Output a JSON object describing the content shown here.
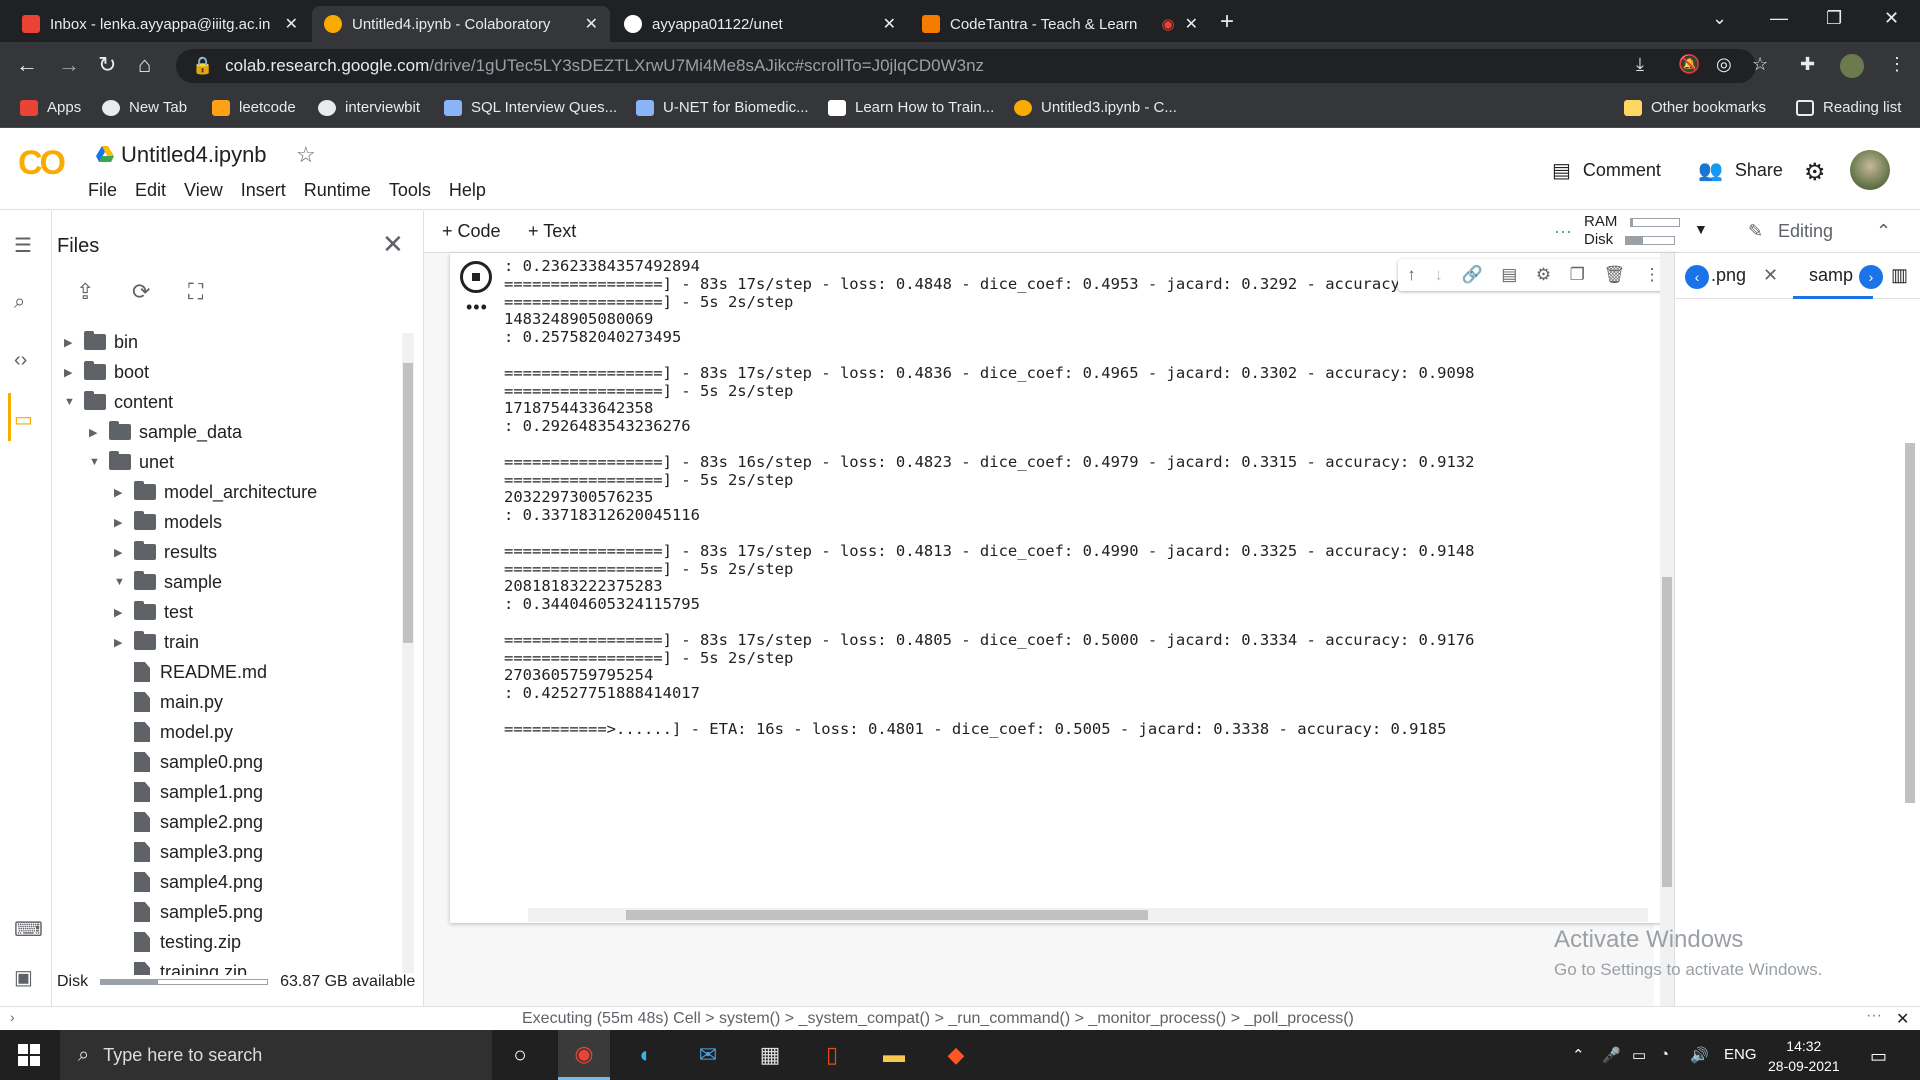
{
  "browser": {
    "tabs": [
      {
        "title": "Inbox - lenka.ayyappa@iiitg.ac.in",
        "icon": "gmail-icon",
        "color": "#ea4335"
      },
      {
        "title": "Untitled4.ipynb - Colaboratory",
        "icon": "colab-icon",
        "color": "#f9ab00"
      },
      {
        "title": "ayyappa01122/unet",
        "icon": "github-icon",
        "color": "#ffffff"
      },
      {
        "title": "CodeTantra - Teach & Learn",
        "icon": "codetantra-icon",
        "color": "#f57c00"
      }
    ],
    "url_host": "colab.research.google.com",
    "url_path": "/drive/1gUTec5LY3sDEZTLXrwU7Mi4Me8sAJikc#scrollTo=J0jlqCD0W3nz",
    "bookmarks": [
      {
        "label": "Apps",
        "color": "#ea4335"
      },
      {
        "label": "New Tab",
        "color": "#e8eaed"
      },
      {
        "label": "leetcode",
        "color": "#ffa116"
      },
      {
        "label": "interviewbit",
        "color": "#e8eaed"
      },
      {
        "label": "SQL Interview Ques...",
        "color": "#8ab4f8"
      },
      {
        "label": "U-NET for Biomedic...",
        "color": "#8ab4f8"
      },
      {
        "label": "Learn How to Train...",
        "color": "#ffffff"
      },
      {
        "label": "Untitled3.ipynb - C...",
        "color": "#f9ab00"
      }
    ],
    "other_bookmarks": "Other bookmarks",
    "reading_list": "Reading list"
  },
  "colab": {
    "logo": "CO",
    "notebook_title": "Untitled4.ipynb",
    "menu": [
      "File",
      "Edit",
      "View",
      "Insert",
      "Runtime",
      "Tools",
      "Help"
    ],
    "comment": "Comment",
    "share": "Share",
    "add_code": "+ Code",
    "add_text": "+ Text",
    "ram_label": "RAM",
    "disk_label": "Disk",
    "ram_fraction": 0.06,
    "disk_fraction": 0.35,
    "editing": "Editing"
  },
  "files": {
    "title": "Files",
    "tree": [
      {
        "name": "bin",
        "type": "folder",
        "depth": 0,
        "state": "collapsed"
      },
      {
        "name": "boot",
        "type": "folder",
        "depth": 0,
        "state": "collapsed"
      },
      {
        "name": "content",
        "type": "folder",
        "depth": 0,
        "state": "expanded"
      },
      {
        "name": "sample_data",
        "type": "folder",
        "depth": 1,
        "state": "collapsed"
      },
      {
        "name": "unet",
        "type": "folder",
        "depth": 1,
        "state": "expanded"
      },
      {
        "name": "model_architecture",
        "type": "folder",
        "depth": 2,
        "state": "collapsed"
      },
      {
        "name": "models",
        "type": "folder",
        "depth": 2,
        "state": "collapsed"
      },
      {
        "name": "results",
        "type": "folder",
        "depth": 2,
        "state": "collapsed"
      },
      {
        "name": "sample",
        "type": "folder",
        "depth": 2,
        "state": "expanded"
      },
      {
        "name": "test",
        "type": "folder",
        "depth": 2,
        "state": "collapsed"
      },
      {
        "name": "train",
        "type": "folder",
        "depth": 2,
        "state": "collapsed"
      },
      {
        "name": "README.md",
        "type": "file",
        "depth": 2
      },
      {
        "name": "main.py",
        "type": "file",
        "depth": 2
      },
      {
        "name": "model.py",
        "type": "file",
        "depth": 2
      },
      {
        "name": "sample0.png",
        "type": "file",
        "depth": 2
      },
      {
        "name": "sample1.png",
        "type": "file",
        "depth": 2
      },
      {
        "name": "sample2.png",
        "type": "file",
        "depth": 2
      },
      {
        "name": "sample3.png",
        "type": "file",
        "depth": 2
      },
      {
        "name": "sample4.png",
        "type": "file",
        "depth": 2
      },
      {
        "name": "sample5.png",
        "type": "file",
        "depth": 2
      },
      {
        "name": "testing.zip",
        "type": "file",
        "depth": 2
      },
      {
        "name": "training.zip",
        "type": "file",
        "depth": 2
      }
    ],
    "disk_label": "Disk",
    "disk_fraction": 0.34,
    "disk_available": "63.87 GB available"
  },
  "output_lines": [
    ": 0.23623384357492894",
    "=================] - 83s 17s/step - loss: 0.4848 - dice_coef: 0.4953 - jacard: 0.3292 - accuracy: 0.9067",
    "=================] - 5s 2s/step",
    "1483248905080069",
    ": 0.257582040273495",
    "",
    "=================] - 83s 17s/step - loss: 0.4836 - dice_coef: 0.4965 - jacard: 0.3302 - accuracy: 0.9098",
    "=================] - 5s 2s/step",
    "1718754433642358",
    ": 0.2926483543236276",
    "",
    "=================] - 83s 16s/step - loss: 0.4823 - dice_coef: 0.4979 - jacard: 0.3315 - accuracy: 0.9132",
    "=================] - 5s 2s/step",
    "2032297300576235",
    ": 0.33718312620045116",
    "",
    "=================] - 83s 17s/step - loss: 0.4813 - dice_coef: 0.4990 - jacard: 0.3325 - accuracy: 0.9148",
    "=================] - 5s 2s/step",
    "20818183222375283",
    ": 0.34404605324115795",
    "",
    "=================] - 83s 17s/step - loss: 0.4805 - dice_coef: 0.5000 - jacard: 0.3334 - accuracy: 0.9176",
    "=================] - 5s 2s/step",
    "2703605759795254",
    ": 0.42527751888414017",
    "",
    "===========>......] - ETA: 16s - loss: 0.4801 - dice_coef: 0.5005 - jacard: 0.3338 - accuracy: 0.9185"
  ],
  "side_panel": {
    "tab1": ".png",
    "tab2": "samp"
  },
  "watermark": {
    "line1": "Activate Windows",
    "line2": "Go to Settings to activate Windows."
  },
  "status": "Executing (55m 48s) Cell > system() > _system_compat() > _run_command() > _monitor_process() > _poll_process()",
  "taskbar": {
    "search_placeholder": "Type here to search",
    "lang": "ENG",
    "time": "14:32",
    "date": "28-09-2021"
  }
}
